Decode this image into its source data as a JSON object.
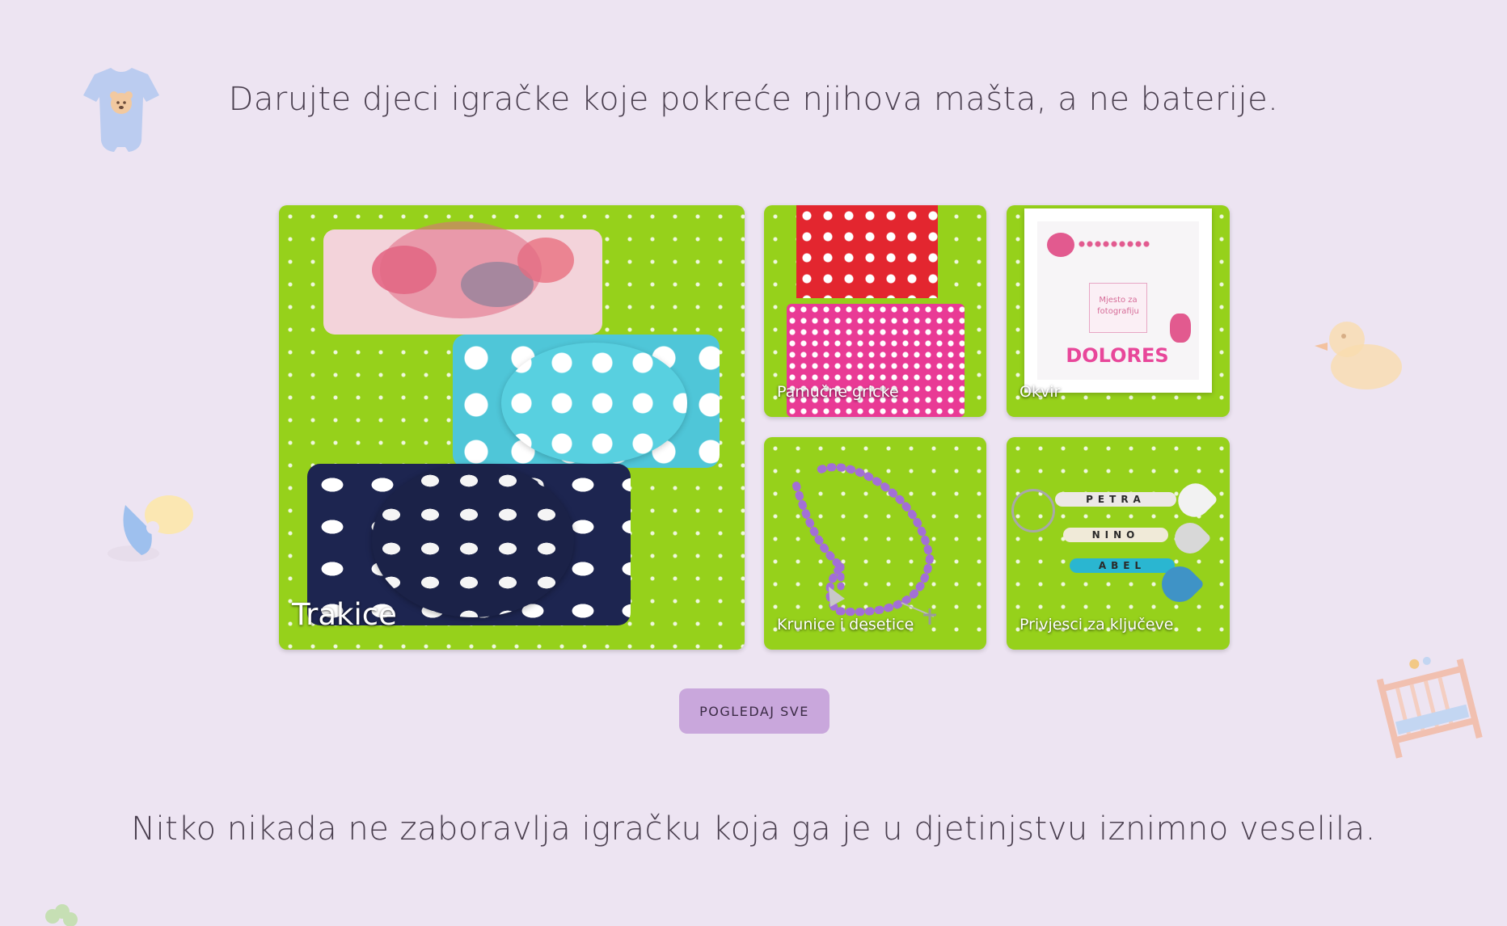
{
  "quotes": {
    "top": "Darujte djeci igračke koje pokreće njihova mašta, a ne baterije.",
    "bottom": "Nitko nikada ne zaboravlja igračku koja ga je u djetinjstvu iznimno veselila."
  },
  "categories": [
    {
      "label": "Trakice"
    },
    {
      "label": "Pamučne gricke"
    },
    {
      "label": "Okvir"
    },
    {
      "label": "Krunice i desetice"
    },
    {
      "label": "Privjesci za ključeve"
    }
  ],
  "frame_photo": {
    "name_text": "DOLORES",
    "photo_placeholder": "Mjesto za fotografiju"
  },
  "keychain_beads": [
    "PETRA",
    "NINO",
    "ABEL"
  ],
  "cta": {
    "label": "POGLEDAJ SVE"
  },
  "decorations": [
    "baby-onesie-icon",
    "rubber-duck-icon",
    "pacifier-icon",
    "crib-icon",
    "clover-icon"
  ],
  "colors": {
    "background": "#ede4f2",
    "button": "#c9a7dc",
    "tile_green": "#96d11b",
    "text": "#4a3f4f"
  }
}
